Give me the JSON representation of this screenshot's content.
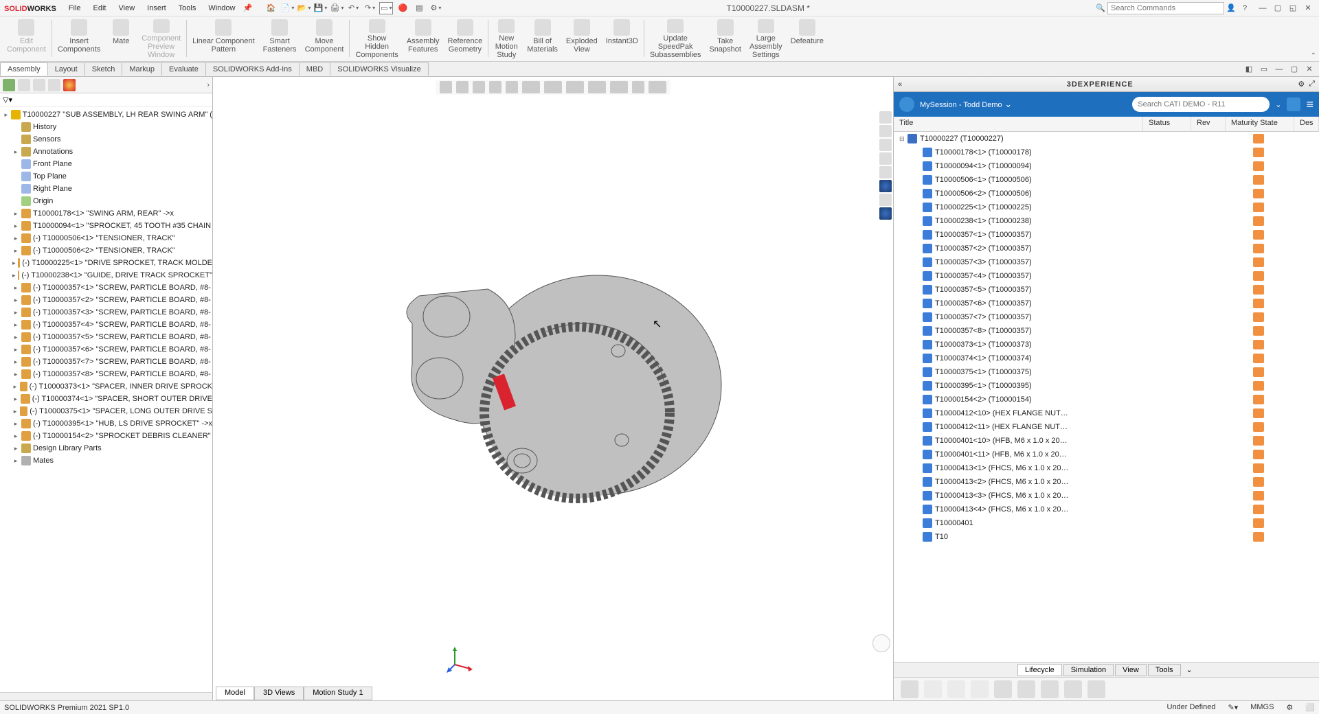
{
  "app_name_a": "SOLID",
  "app_name_b": "WORKS",
  "menus": [
    "File",
    "Edit",
    "View",
    "Insert",
    "Tools",
    "Window"
  ],
  "doc_title": "T10000227.SLDASM *",
  "search_placeholder": "Search Commands",
  "ribbon": [
    {
      "label": "Edit\nComponent",
      "disabled": true
    },
    {
      "label": "Insert\nComponents"
    },
    {
      "label": "Mate"
    },
    {
      "label": "Component\nPreview\nWindow",
      "disabled": true
    },
    {
      "label": "Linear Component\nPattern"
    },
    {
      "label": "Smart\nFasteners"
    },
    {
      "label": "Move\nComponent"
    },
    {
      "label": "Show\nHidden\nComponents"
    },
    {
      "label": "Assembly\nFeatures"
    },
    {
      "label": "Reference\nGeometry"
    },
    {
      "label": "New\nMotion\nStudy"
    },
    {
      "label": "Bill of\nMaterials"
    },
    {
      "label": "Exploded\nView"
    },
    {
      "label": "Instant3D"
    },
    {
      "label": "Update\nSpeedPak\nSubassemblies"
    },
    {
      "label": "Take\nSnapshot"
    },
    {
      "label": "Large\nAssembly\nSettings"
    },
    {
      "label": "Defeature"
    }
  ],
  "tabs": [
    "Assembly",
    "Layout",
    "Sketch",
    "Markup",
    "Evaluate",
    "SOLIDWORKS Add-Ins",
    "MBD",
    "SOLIDWORKS Visualize"
  ],
  "active_tab": "Assembly",
  "tree_root": "T10000227 \"SUB ASSEMBLY, LH REAR SWING ARM\"  (",
  "tree_top": [
    {
      "label": "History",
      "icon": "folder"
    },
    {
      "label": "Sensors",
      "icon": "folder"
    },
    {
      "label": "Annotations",
      "icon": "folder",
      "exp": true
    },
    {
      "label": "Front Plane",
      "icon": "plane"
    },
    {
      "label": "Top Plane",
      "icon": "plane"
    },
    {
      "label": "Right Plane",
      "icon": "plane"
    },
    {
      "label": "Origin",
      "icon": "origin"
    }
  ],
  "tree_parts": [
    "T10000178<1> \"SWING ARM, REAR\" ->x",
    "T10000094<1> \"SPROCKET, 45 TOOTH #35 CHAIN",
    "(-) T10000506<1> \"TENSIONER, TRACK\"",
    "(-) T10000506<2> \"TENSIONER, TRACK\"",
    "(-) T10000225<1> \"DRIVE SPROCKET, TRACK MOLDE",
    "(-) T10000238<1> \"GUIDE, DRIVE TRACK SPROCKET\"",
    "(-) T10000357<1> \"SCREW, PARTICLE BOARD, #8-",
    "(-) T10000357<2> \"SCREW, PARTICLE BOARD, #8-",
    "(-) T10000357<3> \"SCREW, PARTICLE BOARD, #8-",
    "(-) T10000357<4> \"SCREW, PARTICLE BOARD, #8-",
    "(-) T10000357<5> \"SCREW, PARTICLE BOARD, #8-",
    "(-) T10000357<6> \"SCREW, PARTICLE BOARD, #8-",
    "(-) T10000357<7> \"SCREW, PARTICLE BOARD, #8-",
    "(-) T10000357<8> \"SCREW, PARTICLE BOARD, #8-",
    "(-) T10000373<1> \"SPACER, INNER DRIVE SPROCK",
    "(-) T10000374<1> \"SPACER, SHORT OUTER DRIVE",
    "(-) T10000375<1> \"SPACER, LONG OUTER DRIVE S",
    "(-) T10000395<1> \"HUB, LS DRIVE SPROCKET\" ->x",
    "(-) T10000154<2> \"SPROCKET DEBRIS CLEANER\""
  ],
  "tree_bottom": [
    {
      "label": "Design Library Parts",
      "icon": "folder",
      "exp": true
    },
    {
      "label": "Mates",
      "icon": "mate",
      "exp": true
    }
  ],
  "viewport_tabs": [
    "Model",
    "3D Views",
    "Motion Study 1"
  ],
  "rp_title": "3DEXPERIENCE",
  "session_name": "MySession - Todd Demo",
  "rp_search_placeholder": "Search CATI DEMO - R11",
  "rp_columns": [
    "Title",
    "Status",
    "Rev",
    "Maturity State",
    "Des"
  ],
  "rp_root": "T10000227 (T10000227)",
  "rp_items": [
    "T10000178<1> (T10000178)",
    "T10000094<1> (T10000094)",
    "T10000506<1> (T10000506)",
    "T10000506<2> (T10000506)",
    "T10000225<1> (T10000225)",
    "T10000238<1> (T10000238)",
    "T10000357<1> (T10000357)",
    "T10000357<2> (T10000357)",
    "T10000357<3> (T10000357)",
    "T10000357<4> (T10000357)",
    "T10000357<5> (T10000357)",
    "T10000357<6> (T10000357)",
    "T10000357<7> (T10000357)",
    "T10000357<8> (T10000357)",
    "T10000373<1> (T10000373)",
    "T10000374<1> (T10000374)",
    "T10000375<1> (T10000375)",
    "T10000395<1> (T10000395)",
    "T10000154<2> (T10000154)",
    "T10000412<10> (HEX FLANGE NUT…",
    "T10000412<11> (HEX FLANGE NUT…",
    "T10000401<10> (HFB, M6 x 1.0 x 20…",
    "T10000401<11> (HFB, M6 x 1.0 x 20…",
    "T10000413<1> (FHCS, M6 x 1.0 x 20…",
    "T10000413<2> (FHCS, M6 x 1.0 x 20…",
    "T10000413<3> (FHCS, M6 x 1.0 x 20…",
    "T10000413<4> (FHCS, M6 x 1.0 x 20…",
    "T10000401",
    "T10"
  ],
  "rp_bottom_tabs": [
    "Lifecycle",
    "Simulation",
    "View",
    "Tools"
  ],
  "status_left": "SOLIDWORKS Premium 2021 SP1.0",
  "status_right": [
    "Under Defined",
    "",
    "MMGS",
    "",
    ""
  ]
}
